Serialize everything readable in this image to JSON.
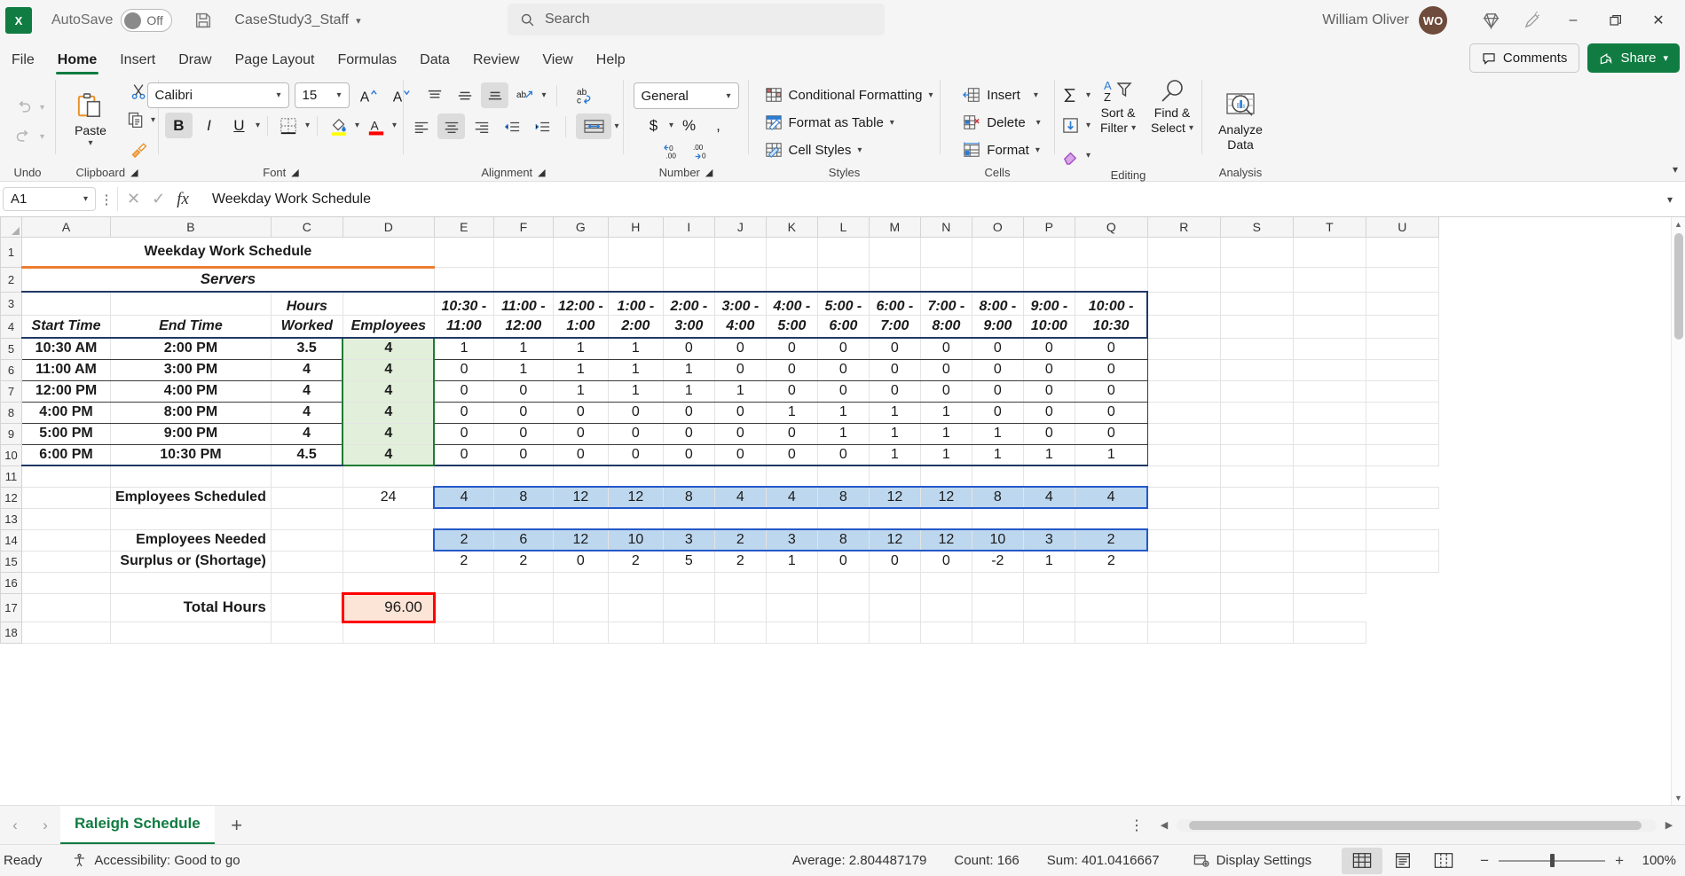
{
  "titlebar": {
    "app_icon": "excel-logo",
    "autosave_label": "AutoSave",
    "autosave_state": "Off",
    "document_name": "CaseStudy3_Staff",
    "search_placeholder": "Search",
    "user_name": "William Oliver",
    "user_initials": "WO",
    "minimize": "–",
    "restore": "❐",
    "close": "✕"
  },
  "tabs": {
    "items": [
      "File",
      "Home",
      "Insert",
      "Draw",
      "Page Layout",
      "Formulas",
      "Data",
      "Review",
      "View",
      "Help"
    ],
    "active": "Home",
    "comments_label": "Comments",
    "share_label": "Share"
  },
  "ribbon": {
    "groups": [
      "Undo",
      "Clipboard",
      "Font",
      "Alignment",
      "Number",
      "Styles",
      "Cells",
      "Editing",
      "Analysis"
    ],
    "clipboard": {
      "paste_label": "Paste"
    },
    "font": {
      "family": "Calibri",
      "size": "15",
      "bold": "B",
      "italic": "I",
      "underline": "U"
    },
    "number": {
      "format": "General"
    },
    "styles": {
      "conditional_formatting": "Conditional Formatting",
      "format_as_table": "Format as Table",
      "cell_styles": "Cell Styles"
    },
    "cells": {
      "insert": "Insert",
      "delete": "Delete",
      "format": "Format"
    },
    "editing": {
      "sort_filter": "Sort &\nFilter",
      "sort_filter_l1": "Sort &",
      "sort_filter_l2": "Filter",
      "find_select_l1": "Find &",
      "find_select_l2": "Select"
    },
    "analysis": {
      "analyze_data_l1": "Analyze",
      "analyze_data_l2": "Data"
    }
  },
  "formula_bar": {
    "name_box": "A1",
    "cancel_icon": "close-icon",
    "confirm_icon": "check-icon",
    "fx_icon": "fx",
    "value": "Weekday Work Schedule"
  },
  "grid": {
    "columns": [
      "A",
      "B",
      "C",
      "D",
      "E",
      "F",
      "G",
      "H",
      "I",
      "J",
      "K",
      "L",
      "M",
      "N",
      "O",
      "P",
      "Q",
      "R",
      "S",
      "T",
      "U"
    ],
    "rows": [
      "1",
      "2",
      "3",
      "4",
      "5",
      "6",
      "7",
      "8",
      "9",
      "10",
      "11",
      "12",
      "13",
      "14",
      "15",
      "16",
      "17",
      "18"
    ]
  },
  "sheet": {
    "title": "Weekday Work Schedule",
    "section": "Servers",
    "headers": {
      "start_time": "Start Time",
      "end_time": "End Time",
      "hours_worked_l1": "Hours",
      "hours_worked_l2": "Worked",
      "employees": "Employees"
    },
    "time_slots": [
      {
        "l1": "10:30 -",
        "l2": "11:00"
      },
      {
        "l1": "11:00 -",
        "l2": "12:00"
      },
      {
        "l1": "12:00 -",
        "l2": "1:00"
      },
      {
        "l1": "1:00 -",
        "l2": "2:00"
      },
      {
        "l1": "2:00 -",
        "l2": "3:00"
      },
      {
        "l1": "3:00 -",
        "l2": "4:00"
      },
      {
        "l1": "4:00 -",
        "l2": "5:00"
      },
      {
        "l1": "5:00 -",
        "l2": "6:00"
      },
      {
        "l1": "6:00 -",
        "l2": "7:00"
      },
      {
        "l1": "7:00 -",
        "l2": "8:00"
      },
      {
        "l1": "8:00 -",
        "l2": "9:00"
      },
      {
        "l1": "9:00 -",
        "l2": "10:00"
      },
      {
        "l1": "10:00 -",
        "l2": "10:30"
      }
    ],
    "shifts": [
      {
        "start": "10:30 AM",
        "end": "2:00 PM",
        "hours": "3.5",
        "employees": "4",
        "slots": [
          "1",
          "1",
          "1",
          "1",
          "0",
          "0",
          "0",
          "0",
          "0",
          "0",
          "0",
          "0",
          "0"
        ]
      },
      {
        "start": "11:00 AM",
        "end": "3:00 PM",
        "hours": "4",
        "employees": "4",
        "slots": [
          "0",
          "1",
          "1",
          "1",
          "1",
          "0",
          "0",
          "0",
          "0",
          "0",
          "0",
          "0",
          "0"
        ]
      },
      {
        "start": "12:00 PM",
        "end": "4:00 PM",
        "hours": "4",
        "employees": "4",
        "slots": [
          "0",
          "0",
          "1",
          "1",
          "1",
          "1",
          "0",
          "0",
          "0",
          "0",
          "0",
          "0",
          "0"
        ]
      },
      {
        "start": "4:00 PM",
        "end": "8:00 PM",
        "hours": "4",
        "employees": "4",
        "slots": [
          "0",
          "0",
          "0",
          "0",
          "0",
          "0",
          "1",
          "1",
          "1",
          "1",
          "0",
          "0",
          "0"
        ]
      },
      {
        "start": "5:00 PM",
        "end": "9:00 PM",
        "hours": "4",
        "employees": "4",
        "slots": [
          "0",
          "0",
          "0",
          "0",
          "0",
          "0",
          "0",
          "1",
          "1",
          "1",
          "1",
          "0",
          "0"
        ]
      },
      {
        "start": "6:00 PM",
        "end": "10:30 PM",
        "hours": "4.5",
        "employees": "4",
        "slots": [
          "0",
          "0",
          "0",
          "0",
          "0",
          "0",
          "0",
          "0",
          "1",
          "1",
          "1",
          "1",
          "1"
        ]
      }
    ],
    "scheduled": {
      "label": "Employees Scheduled",
      "total": "24",
      "values": [
        "4",
        "8",
        "12",
        "12",
        "8",
        "4",
        "4",
        "8",
        "12",
        "12",
        "8",
        "4",
        "4"
      ]
    },
    "needed": {
      "label": "Employees Needed",
      "values": [
        "2",
        "6",
        "12",
        "10",
        "3",
        "2",
        "3",
        "8",
        "12",
        "12",
        "10",
        "3",
        "2"
      ]
    },
    "surplus": {
      "label": "Surplus or (Shortage)",
      "values": [
        "2",
        "2",
        "0",
        "2",
        "5",
        "2",
        "1",
        "0",
        "0",
        "0",
        "-2",
        "1",
        "2"
      ]
    },
    "total_hours": {
      "label": "Total Hours",
      "value": "96.00"
    }
  },
  "sheet_tabs": {
    "items": [
      "Raleigh Schedule"
    ],
    "active": "Raleigh Schedule",
    "add_label": "+"
  },
  "status_bar": {
    "ready": "Ready",
    "accessibility": "Accessibility: Good to go",
    "average": "Average: 2.804487179",
    "count": "Count: 166",
    "sum": "Sum: 401.0416667",
    "display_settings": "Display Settings",
    "zoom": "100%"
  },
  "colors": {
    "excel_green": "#107c41",
    "title_underline": "#ed7d31",
    "navy_border": "#1f3864",
    "green_select": "#1e7b35",
    "green_fill": "#e2efda",
    "blue_fill": "#bdd7ee",
    "blue_border": "#2458c9",
    "red_border": "#ff0000",
    "red_fill": "#fce4d6",
    "avatar": "#6e4b3a"
  }
}
